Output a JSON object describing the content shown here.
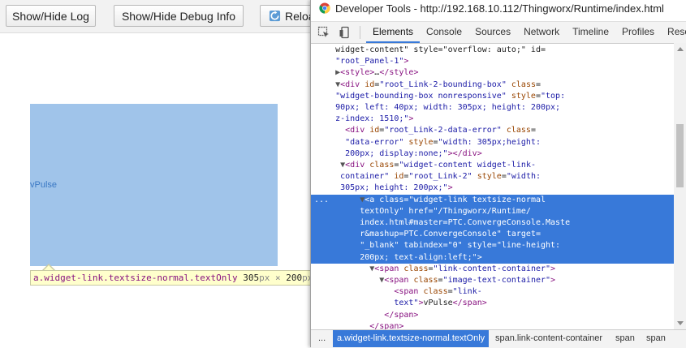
{
  "toolbar_left": {
    "show_hide_log": "Show/Hide Log",
    "show_hide_debug": "Show/Hide Debug Info",
    "reload": "Reload"
  },
  "widget": {
    "link_text": "vPulse"
  },
  "tooltip": {
    "selector": "a.widget-link.textsize-normal.textOnly",
    "width_value": "305",
    "unit": "px",
    "times": "×",
    "height_value": "200",
    "height_unit": "px"
  },
  "devtools": {
    "title": "Developer Tools - http://192.168.10.112/Thingworx/Runtime/index.html",
    "tabs": [
      "Elements",
      "Console",
      "Sources",
      "Network",
      "Timeline",
      "Profiles",
      "Reso"
    ],
    "dom_lines": [
      {
        "parts": [
          [
            "tx",
            "     widget-content\" style=\"overflow: auto;\" id="
          ]
        ]
      },
      {
        "parts": [
          [
            "av",
            "     \"root_Panel-1\""
          ],
          [
            "tag",
            ">"
          ]
        ]
      },
      {
        "parts": [
          [
            "tri",
            "     ▶"
          ],
          [
            "tag",
            "<style>"
          ],
          [
            "tx",
            "…"
          ],
          [
            "tag",
            "</style>"
          ]
        ]
      },
      {
        "parts": [
          [
            "tri",
            "     ▼"
          ],
          [
            "tag",
            "<div "
          ],
          [
            "an",
            "id"
          ],
          [
            "tx",
            "="
          ],
          [
            "av",
            "\"root_Link-2-bounding-box\""
          ],
          [
            "an",
            " class"
          ],
          [
            "tx",
            "="
          ]
        ]
      },
      {
        "parts": [
          [
            "av",
            "     \"widget-bounding-box nonresponsive\""
          ],
          [
            "an",
            " style"
          ],
          [
            "tx",
            "="
          ],
          [
            "av",
            "\"top:"
          ]
        ]
      },
      {
        "parts": [
          [
            "av",
            "     90px; left: 40px; width: 305px; height: 200px;"
          ]
        ]
      },
      {
        "parts": [
          [
            "av",
            "     z-index: 1510;\""
          ],
          [
            "tag",
            ">"
          ]
        ]
      },
      {
        "parts": [
          [
            "tag",
            "       <div "
          ],
          [
            "an",
            "id"
          ],
          [
            "tx",
            "="
          ],
          [
            "av",
            "\"root_Link-2-data-error\""
          ],
          [
            "an",
            " class"
          ],
          [
            "tx",
            "="
          ]
        ]
      },
      {
        "parts": [
          [
            "av",
            "       \"data-error\""
          ],
          [
            "an",
            " style"
          ],
          [
            "tx",
            "="
          ],
          [
            "av",
            "\"width: 305px;height:"
          ]
        ]
      },
      {
        "parts": [
          [
            "av",
            "       200px; display:none;\""
          ],
          [
            "tag",
            "></div>"
          ]
        ]
      },
      {
        "parts": [
          [
            "tri",
            "      ▼"
          ],
          [
            "tag",
            "<div "
          ],
          [
            "an",
            "class"
          ],
          [
            "tx",
            "="
          ],
          [
            "av",
            "\"widget-content widget-link-"
          ]
        ]
      },
      {
        "parts": [
          [
            "av",
            "      container\""
          ],
          [
            "an",
            " id"
          ],
          [
            "tx",
            "="
          ],
          [
            "av",
            "\"root_Link-2\""
          ],
          [
            "an",
            " style"
          ],
          [
            "tx",
            "="
          ],
          [
            "av",
            "\"width:"
          ]
        ]
      },
      {
        "parts": [
          [
            "av",
            "      305px; height: 200px;\""
          ],
          [
            "tag",
            ">"
          ]
        ]
      },
      {
        "parts": [
          [
            "tri",
            "          ▼"
          ],
          [
            "tag",
            "<a "
          ],
          [
            "an",
            "class"
          ],
          [
            "tx",
            "="
          ],
          [
            "av",
            "\"widget-link textsize-normal"
          ]
        ],
        "sel": true
      },
      {
        "parts": [
          [
            "av",
            "          textOnly\""
          ],
          [
            "an",
            " href"
          ],
          [
            "tx",
            "="
          ],
          [
            "av",
            "\"/Thingworx/Runtime/"
          ]
        ],
        "sel": true
      },
      {
        "parts": [
          [
            "av",
            "          index.html#master=PTC.ConvergeConsole.Maste"
          ]
        ],
        "sel": true
      },
      {
        "parts": [
          [
            "av",
            "          r&mashup=PTC.ConvergeConsole\""
          ],
          [
            "an",
            " target"
          ],
          [
            "tx",
            "="
          ]
        ],
        "sel": true
      },
      {
        "parts": [
          [
            "av",
            "          \"_blank\""
          ],
          [
            "an",
            " tabindex"
          ],
          [
            "tx",
            "="
          ],
          [
            "av",
            "\"0\""
          ],
          [
            "an",
            " style"
          ],
          [
            "tx",
            "="
          ],
          [
            "av",
            "\"line-height:"
          ]
        ],
        "sel": true
      },
      {
        "parts": [
          [
            "av",
            "          200px; text-align:left;\""
          ],
          [
            "tag",
            ">"
          ]
        ],
        "sel": true
      },
      {
        "parts": [
          [
            "tri",
            "            ▼"
          ],
          [
            "tag",
            "<span "
          ],
          [
            "an",
            "class"
          ],
          [
            "tx",
            "="
          ],
          [
            "av",
            "\"link-content-container\""
          ],
          [
            "tag",
            ">"
          ]
        ]
      },
      {
        "parts": [
          [
            "tri",
            "              ▼"
          ],
          [
            "tag",
            "<span "
          ],
          [
            "an",
            "class"
          ],
          [
            "tx",
            "="
          ],
          [
            "av",
            "\"image-text-container\""
          ],
          [
            "tag",
            ">"
          ]
        ]
      },
      {
        "parts": [
          [
            "tag",
            "                 <span "
          ],
          [
            "an",
            "class"
          ],
          [
            "tx",
            "="
          ],
          [
            "av",
            "\"link-"
          ]
        ]
      },
      {
        "parts": [
          [
            "av",
            "                 text\""
          ],
          [
            "tag",
            ">"
          ],
          [
            "tx",
            "vPulse"
          ],
          [
            "tag",
            "</span>"
          ]
        ]
      },
      {
        "parts": [
          [
            "tag",
            "               </span>"
          ]
        ]
      },
      {
        "parts": [
          [
            "tag",
            "            </span>"
          ]
        ]
      }
    ],
    "breadcrumbs": [
      "...",
      "a.widget-link.textsize-normal.textOnly",
      "span.link-content-container",
      "span",
      "span"
    ],
    "accent_color": "#3879d9"
  }
}
